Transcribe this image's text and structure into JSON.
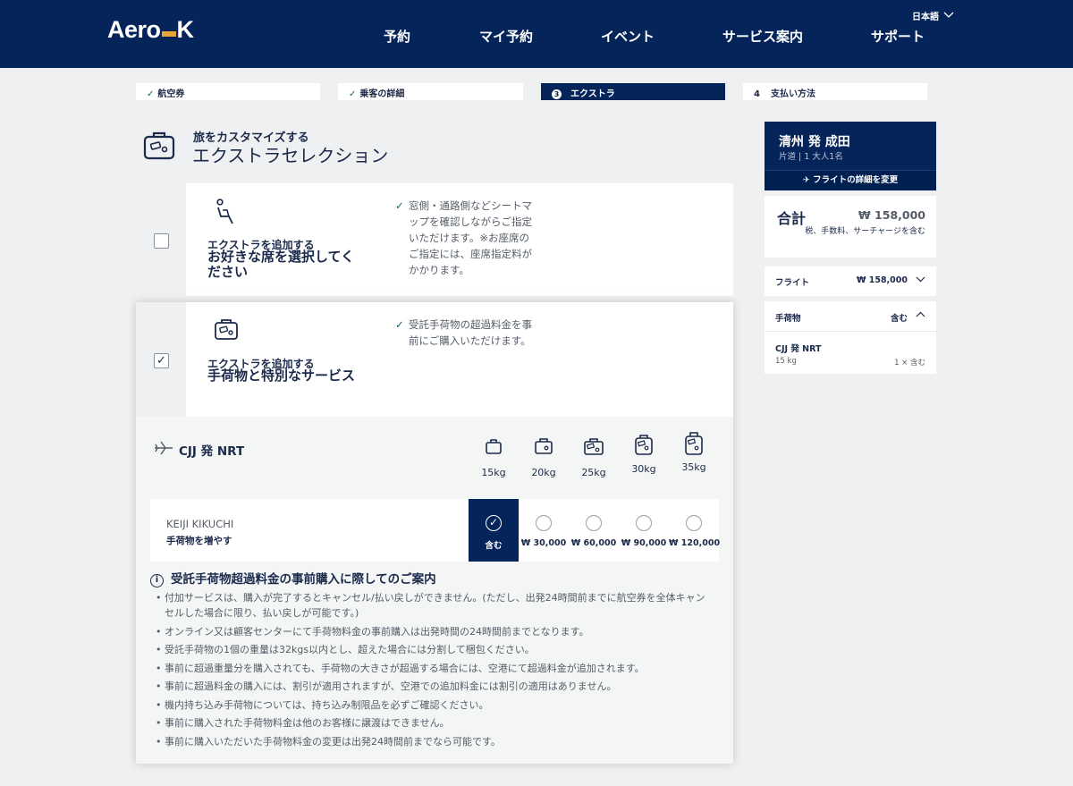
{
  "header": {
    "logo": {
      "left": "Aero",
      "right": "K"
    },
    "language": "日本語",
    "nav": [
      "予約",
      "マイ予約",
      "イベント",
      "サービス案内",
      "サポート"
    ]
  },
  "steps": [
    {
      "label": "航空券",
      "state": "done"
    },
    {
      "label": "乗客の詳細",
      "state": "done"
    },
    {
      "num": "3",
      "label": "エクストラ",
      "state": "active"
    },
    {
      "num": "4",
      "label": "支払い方法",
      "state": "pending"
    }
  ],
  "title": {
    "sub": "旅をカスタマイズする",
    "main": "エクストラセレクション"
  },
  "seat_card": {
    "checked": false,
    "add_label": "エクストラを追加する",
    "heading_line1": "お好きな席を選択してく",
    "heading_line2": "ださい",
    "desc_lines": [
      "窓側・通路側などシートマ",
      "ップを確認しながらご指定",
      "いただけます。※お座席の",
      "ご指定には、座席指定料が",
      "かかります。"
    ]
  },
  "bag_card": {
    "checked": true,
    "add_label": "エクストラを追加する",
    "heading": "手荷物と特別なサービス",
    "desc_lines": [
      "受託手荷物の超過料金を事",
      "前にご購入いただけます。"
    ],
    "route": "CJJ 発 NRT",
    "weights": [
      "15kg",
      "20kg",
      "25kg",
      "30kg",
      "35kg"
    ],
    "passenger": {
      "name": "KEIJI KIKUCHI",
      "sub": "手荷物を増やす"
    },
    "prices": [
      "含む",
      "₩ 30,000",
      "₩ 60,000",
      "₩ 90,000",
      "₩ 120,000"
    ],
    "selected_price_index": 0,
    "notice_title": "受託手荷物超過料金の事前購入に際してのご案内",
    "notices": [
      "付加サービスは、購入が完了するとキャンセル/払い戻しができません。(ただし、出発24時間前までに航空券を全体キャン",
      "セルした場合に限り、払い戻しが可能です。)",
      "オンライン又は顧客センターにて手荷物料金の事前購入は出発時間の24時間前までとなります。",
      "受託手荷物の1個の重量は32kgs以内とし、超えた場合には分割して梱包ください。",
      "事前に超過重量分を購入されても、手荷物の大きさが超過する場合には、空港にて超過料金が追加されます。",
      "事前に超過料金の購入には、割引が適用されますが、空港での追加料金には割引の適用はありません。",
      "機内持ち込み手荷物については、持ち込み制限品を必ずご確認ください。",
      "事前に購入された手荷物料金は他のお客様に譲渡はできません。",
      "事前に購入いただいた手荷物料金の変更は出発24時間前までなら可能です。"
    ]
  },
  "summary": {
    "route": "清州 発 成田",
    "trip": "片道 | 1 大人1名",
    "change_button": "フライトの詳細を変更",
    "total_label": "合計",
    "total_value": "₩ 158,000",
    "total_note": "税、手数料、サーチャージを含む",
    "flight_label": "フライト",
    "flight_value": "₩ 158,000",
    "bag_label": "手荷物",
    "bag_value": "含む",
    "bag_route": "CJJ 発 NRT",
    "bag_weight": "15 kg",
    "bag_qty": "1 × 含む"
  },
  "colors": {
    "navy": "#04245a",
    "accent": "#e8a53a",
    "background": "#eff0f2",
    "teal_check": "#1b5c66"
  }
}
